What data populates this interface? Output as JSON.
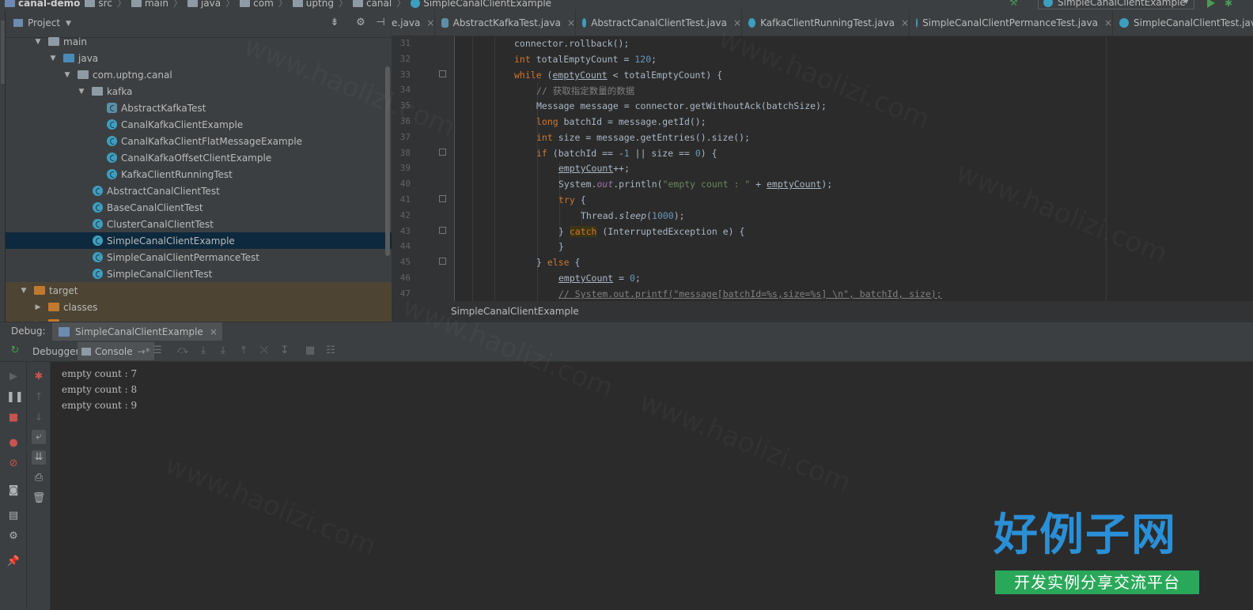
{
  "breadcrumb": {
    "items": [
      "canal-demo",
      "src",
      "main",
      "java",
      "com",
      "uptng",
      "canal",
      "SimpleCanalClientExample"
    ]
  },
  "run_config": {
    "selected": "SimpleCanalClientExample"
  },
  "project_panel": {
    "title": "Project",
    "tree": [
      {
        "label": "main",
        "type": "folder"
      },
      {
        "label": "java",
        "type": "source-folder"
      },
      {
        "label": "com.uptng.canal",
        "type": "package"
      },
      {
        "label": "kafka",
        "type": "package"
      },
      {
        "label": "AbstractKafkaTest",
        "type": "abstract-class"
      },
      {
        "label": "CanalKafkaClientExample",
        "type": "class"
      },
      {
        "label": "CanalKafkaClientFlatMessageExample",
        "type": "class"
      },
      {
        "label": "CanalKafkaOffsetClientExample",
        "type": "class"
      },
      {
        "label": "KafkaClientRunningTest",
        "type": "class"
      },
      {
        "label": "AbstractCanalClientTest",
        "type": "class"
      },
      {
        "label": "BaseCanalClientTest",
        "type": "class"
      },
      {
        "label": "ClusterCanalClientTest",
        "type": "class"
      },
      {
        "label": "SimpleCanalClientExample",
        "type": "class",
        "selected": true
      },
      {
        "label": "SimpleCanalClientPermanceTest",
        "type": "class"
      },
      {
        "label": "SimpleCanalClientTest",
        "type": "class"
      },
      {
        "label": "target",
        "type": "folder"
      },
      {
        "label": "classes",
        "type": "folder"
      }
    ]
  },
  "editor_tabs": [
    {
      "label": "e.java"
    },
    {
      "label": "AbstractKafkaTest.java"
    },
    {
      "label": "AbstractCanalClientTest.java"
    },
    {
      "label": "KafkaClientRunningTest.java"
    },
    {
      "label": "SimpleCanalClientPermanceTest.java"
    },
    {
      "label": "SimpleCanalClientTest.java"
    }
  ],
  "editor": {
    "line_numbers": [
      "31",
      "32",
      "33",
      "34",
      "35",
      "36",
      "37",
      "38",
      "39",
      "40",
      "41",
      "42",
      "43",
      "44",
      "45",
      "46",
      "47"
    ],
    "footer": "SimpleCanalClientExample"
  },
  "debug": {
    "label": "Debug:",
    "session_tab": "SimpleCanalClientExample",
    "subtabs": {
      "debugger": "Debugger",
      "console": "Console"
    },
    "console_lines": [
      "empty count : 7",
      "empty count : 8",
      "empty count : 9"
    ]
  },
  "watermark": {
    "title": "好例子网",
    "subtitle": "开发实例分享交流平台",
    "diagonal": "www.haolizi.com"
  },
  "colors": {
    "keyword": "#cc7832",
    "number": "#6897bb",
    "string": "#6a8759",
    "comment": "#808080",
    "field": "#9876aa",
    "selection": "#0d293e",
    "watermark_blue": "#2a8fd6",
    "watermark_green": "#2aa85a"
  }
}
